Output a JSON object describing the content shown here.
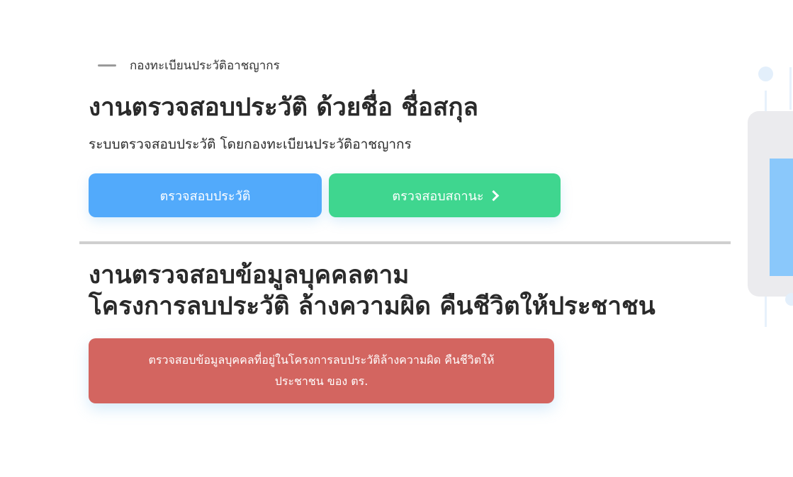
{
  "header": {
    "eyebrow": "กองทะเบียนประวัติอาชญากร",
    "title": "งานตรวจสอบประวัติ ด้วยชื่อ ชื่อสกุล",
    "subtitle": "ระบบตรวจสอบประวัติ โดยกองทะเบียนประวัติอาชญากร"
  },
  "actions": {
    "check_history_label": "ตรวจสอบประวัติ",
    "check_status_label": "ตรวจสอบสถานะ"
  },
  "section2": {
    "title_line1": "งานตรวจสอบข้อมูลบุคคลตาม",
    "title_line2": "โครงการลบประวัติ ล้างความผิด คืนชีวิตให้ประชาชน",
    "button_line1": "ตรวจสอบข้อมูลบุคคลที่อยู่ในโครงการลบประวัติล้างความผิด คืนชีวิตให้",
    "button_line2": "ประชาชน ของ ตร."
  },
  "colors": {
    "blue_button": "#52aafb",
    "green_button": "#3fd68f",
    "red_button": "#d36560"
  },
  "icons": {
    "status_button_icon": "chevron-right-icon"
  }
}
